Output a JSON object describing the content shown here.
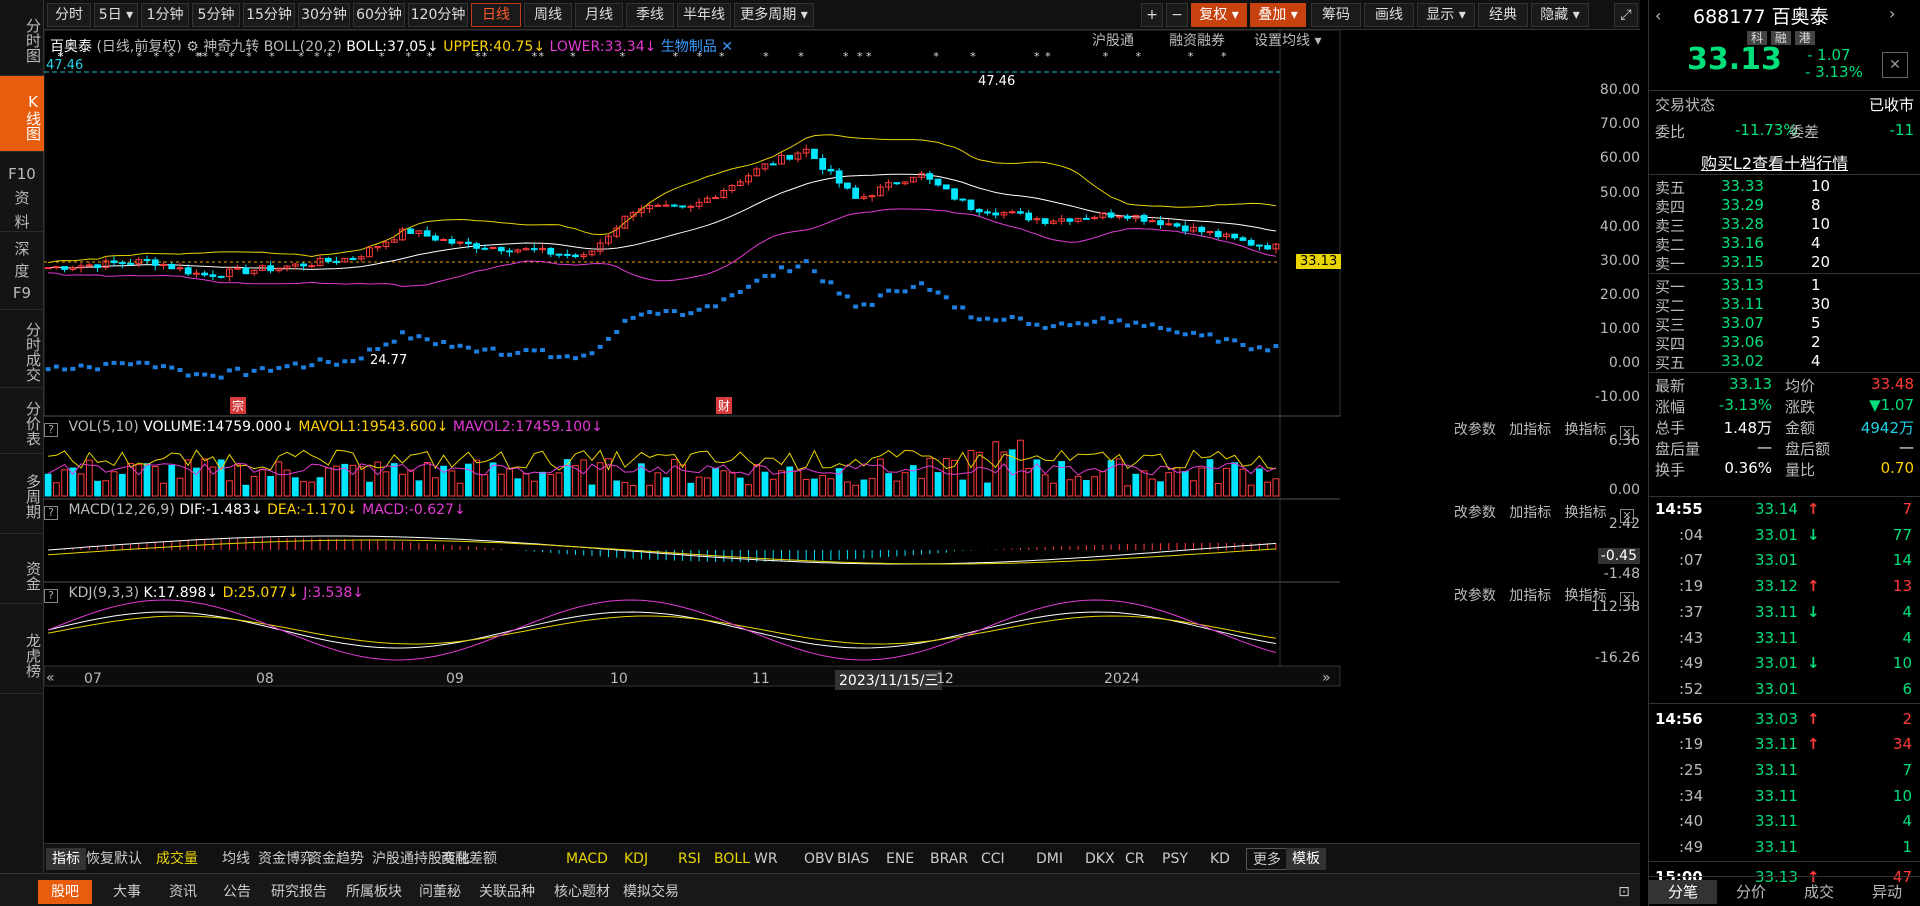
{
  "left_nav": [
    "分时图",
    "K线图",
    "F10资料",
    "深度F9",
    "分时成交",
    "分价表",
    "多周期",
    "资金",
    "龙虎榜"
  ],
  "top_periods": [
    "分时",
    "5日 ▾",
    "1分钟",
    "5分钟",
    "15分钟",
    "30分钟",
    "60分钟",
    "120分钟",
    "日线",
    "周线",
    "月线",
    "季线",
    "半年线",
    "更多周期 ▾"
  ],
  "top_right_buttons": [
    "+",
    "−",
    "复权 ▾",
    "叠加 ▾",
    "筹码",
    "画线",
    "显示 ▾",
    "经典",
    "隐藏 ▾"
  ],
  "main_legend": {
    "name": "百奥泰",
    "mode": "(日线,前复权)",
    "tool": "神奇九转",
    "boll": "BOLL(20,2)",
    "boll_val": "BOLL:37.05↓",
    "upper": "UPPER:40.75↓",
    "lower": "LOWER:33.34↓",
    "sector": "生物制品 ✕",
    "right_links": [
      "沪股通",
      "融资融券",
      "设置均线 ▾"
    ]
  },
  "price_axis": [
    "80.00",
    "70.00",
    "60.00",
    "50.00",
    "40.00",
    "30.00",
    "20.00",
    "10.00",
    "0.00",
    "-10.00"
  ],
  "current_price_tag": "33.13",
  "high_label": "47.46",
  "high_marker": "47.46",
  "low_label": "24.77",
  "event_badges": [
    "宗",
    "财"
  ],
  "vol_legend": {
    "title": "VOL(5,10)",
    "volume": "VOLUME:14759.000↓",
    "mavol1": "MAVOL1:19543.600↓",
    "mavol2": "MAVOL2:17459.100↓"
  },
  "vol_axis": [
    "6.36",
    "0.00"
  ],
  "macd_legend": {
    "title": "MACD(12,26,9)",
    "dif": "DIF:-1.483↓",
    "dea": "DEA:-1.170↓",
    "macd": "MACD:-0.627↓"
  },
  "macd_axis": [
    "2.42",
    "-0.45",
    "-1.48"
  ],
  "kdj_legend": {
    "title": "KDJ(9,3,3)",
    "k": "K:17.898↓",
    "d": "D:25.077↓",
    "j": "J:3.538↓"
  },
  "kdj_axis": [
    "112.38",
    "-16.26"
  ],
  "panel_links": [
    "改参数",
    "加指标",
    "换指标"
  ],
  "time_axis": [
    "07",
    "08",
    "09",
    "10",
    "11",
    "2023/11/15/三",
    "12",
    "2024"
  ],
  "indicator_tabs": [
    "指标",
    "恢复默认",
    "成交量",
    "均线",
    "资金博弈",
    "资金趋势",
    "沪股通持股变化",
    "两融差额",
    "MACD",
    "KDJ",
    "RSI",
    "BOLL",
    "WR",
    "OBV",
    "BIAS",
    "ENE",
    "BRAR",
    "CCI",
    "DMI",
    "DKX",
    "CR",
    "PSY",
    "KD",
    "更多",
    "模板"
  ],
  "bottom_tabs": [
    "股吧",
    "大事",
    "资讯",
    "公告",
    "研究报告",
    "所属板块",
    "问董秘",
    "关联品种",
    "核心题材",
    "模拟交易"
  ],
  "quote": {
    "code": "688177",
    "name": "百奥泰",
    "tags": [
      "科",
      "融",
      "港"
    ],
    "price": "33.13",
    "change": "- 1.07",
    "change_pct": "- 3.13%",
    "status_label": "交易状态",
    "status": "已收市",
    "weibi_label": "委比",
    "weibi": "-11.73%",
    "weicha_label": "委差",
    "weicha": "-11",
    "l2_link": "购买L2查看十档行情",
    "asks": [
      [
        "卖五",
        "33.33",
        "10"
      ],
      [
        "卖四",
        "33.29",
        "8"
      ],
      [
        "卖三",
        "33.28",
        "10"
      ],
      [
        "卖二",
        "33.16",
        "4"
      ],
      [
        "卖一",
        "33.15",
        "20"
      ]
    ],
    "bids": [
      [
        "买一",
        "33.13",
        "1"
      ],
      [
        "买二",
        "33.11",
        "30"
      ],
      [
        "买三",
        "33.07",
        "5"
      ],
      [
        "买四",
        "33.06",
        "2"
      ],
      [
        "买五",
        "33.02",
        "4"
      ]
    ],
    "stats": [
      [
        "最新",
        "33.13",
        "均价",
        "33.48"
      ],
      [
        "涨幅",
        "-3.13%",
        "涨跌",
        "▼1.07"
      ],
      [
        "总手",
        "1.48万",
        "金额",
        "4942万"
      ],
      [
        "盘后量",
        "—",
        "盘后额",
        "—"
      ],
      [
        "换手",
        "0.36%",
        "量比",
        "0.70"
      ]
    ]
  },
  "ticks": [
    [
      "14:55",
      "33.14",
      "↑",
      "7"
    ],
    [
      ":04",
      "33.01",
      "↓",
      "77"
    ],
    [
      ":07",
      "33.01",
      "",
      "14"
    ],
    [
      ":19",
      "33.12",
      "↑",
      "13"
    ],
    [
      ":37",
      "33.11",
      "↓",
      "4"
    ],
    [
      ":43",
      "33.11",
      "",
      "4"
    ],
    [
      ":49",
      "33.01",
      "↓",
      "10"
    ],
    [
      ":52",
      "33.01",
      "",
      "6"
    ],
    [
      "14:56",
      "33.03",
      "↑",
      "2"
    ],
    [
      ":19",
      "33.11",
      "↑",
      "34"
    ],
    [
      ":25",
      "33.11",
      "",
      "7"
    ],
    [
      ":34",
      "33.11",
      "",
      "10"
    ],
    [
      ":40",
      "33.11",
      "",
      "4"
    ],
    [
      ":49",
      "33.11",
      "",
      "1"
    ],
    [
      "15:00",
      "33.13",
      "↑",
      "47"
    ]
  ],
  "right_tabs": [
    "分笔",
    "分价",
    "成交",
    "异动"
  ],
  "colors": {
    "up": "#ff3b3b",
    "down": "#00e6ff",
    "boll_mid": "#ffffff",
    "boll_up": "#e8d400",
    "boll_low": "#e43bd6",
    "accent": "#e85c0d"
  }
}
